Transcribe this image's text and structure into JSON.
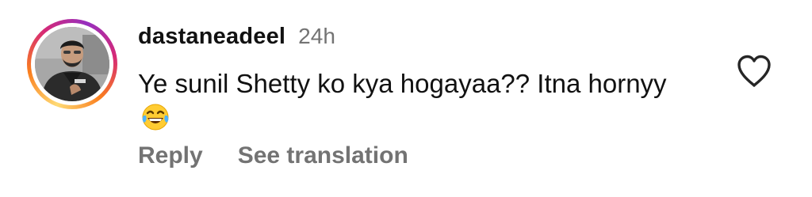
{
  "comment": {
    "username": "dastaneadeel",
    "timestamp": "24h",
    "text": "Ye sunil Shetty ko kya hogayaa?? Itna hornyy",
    "emoji": "face-with-tears-of-joy",
    "actions": {
      "reply": "Reply",
      "see_translation": "See translation"
    },
    "like_icon": "heart-outline-icon",
    "colors": {
      "text": "#111111",
      "muted": "#737373",
      "story_ring": [
        "#feda75",
        "#fa7e1e",
        "#d62976",
        "#962fbf"
      ]
    }
  }
}
